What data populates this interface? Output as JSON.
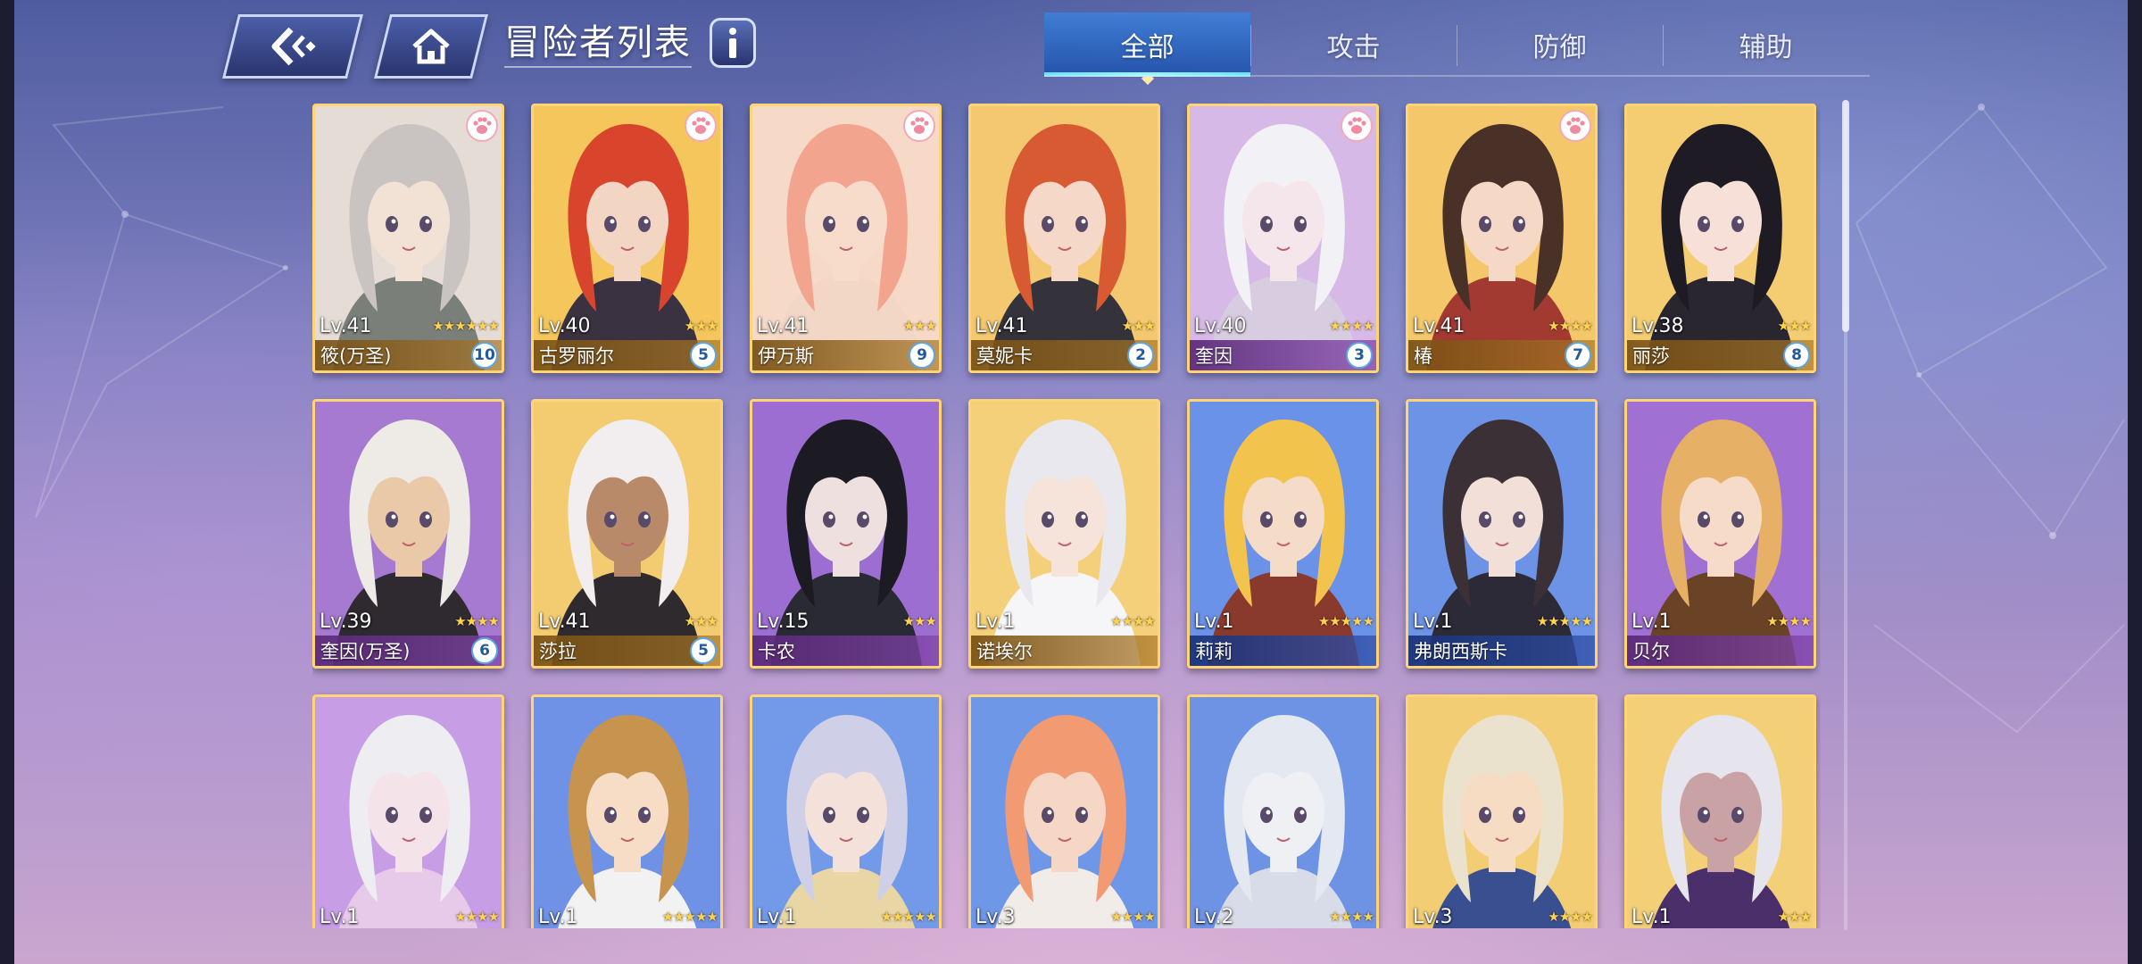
{
  "header": {
    "title": "冒险者列表",
    "tabs": [
      "全部",
      "攻击",
      "防御",
      "辅助"
    ],
    "active_tab": 0
  },
  "colors": {
    "gold": "#ffd474",
    "accent": "#6fe0ff",
    "star": "#ffd34f"
  },
  "cards": [
    {
      "level": "Lv.41",
      "name": "筱(万圣)",
      "rank": "10",
      "stars": "★★★★★★",
      "frame": "gold",
      "paw": true,
      "skin": "#f2e2d6",
      "hair": "#c9c4c2",
      "cloth": "#7a7f7a",
      "bg": "#e6dcd6"
    },
    {
      "level": "Lv.40",
      "name": "古罗丽尔",
      "rank": "5",
      "stars": "★★★",
      "frame": "gold",
      "paw": true,
      "skin": "#f3d5c4",
      "hair": "#d9452c",
      "cloth": "#3a3240",
      "bg": "#f4c65c"
    },
    {
      "level": "Lv.41",
      "name": "伊万斯",
      "rank": "9",
      "stars": "★★★",
      "frame": "gold",
      "paw": true,
      "skin": "#f7dccb",
      "hair": "#f2a48e",
      "cloth": "#f2d7c6",
      "bg": "#f6d9c6"
    },
    {
      "level": "Lv.41",
      "name": "莫妮卡",
      "rank": "2",
      "stars": "★★★",
      "frame": "gold",
      "paw": false,
      "skin": "#f5d8c8",
      "hair": "#d75a32",
      "cloth": "#34323a",
      "bg": "#f4c870"
    },
    {
      "level": "Lv.40",
      "name": "奎因",
      "rank": "3",
      "stars": "★★★★",
      "frame": "purple",
      "paw": true,
      "skin": "#f4e6ea",
      "hair": "#f2f2f6",
      "cloth": "#d8cde0",
      "bg": "#d6b9e6"
    },
    {
      "level": "Lv.41",
      "name": "椿",
      "rank": "7",
      "stars": "★★★★",
      "frame": "gold",
      "paw": true,
      "skin": "#f6d8c6",
      "hair": "#4a3128",
      "cloth": "#a23a32",
      "bg": "#f3c76a"
    },
    {
      "level": "Lv.38",
      "name": "丽莎",
      "rank": "8",
      "stars": "★★★",
      "frame": "gold",
      "paw": false,
      "skin": "#f7e0d8",
      "hair": "#1f1b24",
      "cloth": "#2a2630",
      "bg": "#f4cd73"
    },
    {
      "level": "Lv.39",
      "name": "奎因(万圣)",
      "rank": "6",
      "stars": "★★★★",
      "frame": "purple",
      "paw": false,
      "skin": "#e9c9a8",
      "hair": "#eeeae6",
      "cloth": "#2f2a30",
      "bg": "#a57ad0"
    },
    {
      "level": "Lv.41",
      "name": "莎拉",
      "rank": "5",
      "stars": "★★★",
      "frame": "gold",
      "paw": false,
      "skin": "#b98a6a",
      "hair": "#f2eef0",
      "cloth": "#2e2a2e",
      "bg": "#f3cc72"
    },
    {
      "level": "Lv.15",
      "name": "卡农",
      "rank": "",
      "stars": "★★★",
      "frame": "purple",
      "paw": false,
      "skin": "#efe0e0",
      "hair": "#1c1a22",
      "cloth": "#2a2a34",
      "bg": "#9c6ed2"
    },
    {
      "level": "Lv.1",
      "name": "诺埃尔",
      "rank": "",
      "stars": "★★★★",
      "frame": "gold",
      "paw": false,
      "skin": "#f6e4da",
      "hair": "#e8e8ee",
      "cloth": "#f6f6f8",
      "bg": "#f4d07a"
    },
    {
      "level": "Lv.1",
      "name": "莉莉",
      "rank": "",
      "stars": "★★★★★",
      "frame": "blue",
      "paw": false,
      "skin": "#f5dcc8",
      "hair": "#f2c44e",
      "cloth": "#8a3a2c",
      "bg": "#6a92e8"
    },
    {
      "level": "Lv.1",
      "name": "弗朗西斯卡",
      "rank": "",
      "stars": "★★★★★",
      "frame": "blue",
      "paw": false,
      "skin": "#f2e0d8",
      "hair": "#3a3036",
      "cloth": "#2c2a36",
      "bg": "#6d93e6"
    },
    {
      "level": "Lv.1",
      "name": "贝尔",
      "rank": "",
      "stars": "★★★★",
      "frame": "purple",
      "paw": false,
      "skin": "#f6dcc8",
      "hair": "#e6b066",
      "cloth": "#6a4226",
      "bg": "#a070d2"
    },
    {
      "level": "Lv.1",
      "name": "",
      "rank": "",
      "stars": "★★★★",
      "frame": "purple",
      "paw": false,
      "skin": "#f4e4ea",
      "hair": "#eeeef2",
      "cloth": "#e7c9ea",
      "bg": "#c79ee6"
    },
    {
      "level": "Lv.1",
      "name": "",
      "rank": "",
      "stars": "★★★★★",
      "frame": "blue",
      "paw": false,
      "skin": "#f7dcc6",
      "hair": "#c79450",
      "cloth": "#f2f2f2",
      "bg": "#6f92e6"
    },
    {
      "level": "Lv.1",
      "name": "",
      "rank": "",
      "stars": "★★★★★",
      "frame": "blue",
      "paw": false,
      "skin": "#f4e2da",
      "hair": "#cfd0e8",
      "cloth": "#e8d6a4",
      "bg": "#739ae8"
    },
    {
      "level": "Lv.3",
      "name": "",
      "rank": "",
      "stars": "★★★★",
      "frame": "blue",
      "paw": false,
      "skin": "#f6d6c4",
      "hair": "#f29a72",
      "cloth": "#f2ece8",
      "bg": "#6f97e8"
    },
    {
      "level": "Lv.2",
      "name": "",
      "rank": "",
      "stars": "★★★★",
      "frame": "blue",
      "paw": false,
      "skin": "#eef0f4",
      "hair": "#e4e8f0",
      "cloth": "#d8dce8",
      "bg": "#6e93e4"
    },
    {
      "level": "Lv.3",
      "name": "",
      "rank": "",
      "stars": "★★★★",
      "frame": "gold",
      "paw": false,
      "skin": "#f6dcc2",
      "hair": "#eae2cc",
      "cloth": "#3a4f90",
      "bg": "#f3cd73"
    },
    {
      "level": "Lv.1",
      "name": "",
      "rank": "",
      "stars": "★★★",
      "frame": "gold",
      "paw": false,
      "skin": "#c9a2a6",
      "hair": "#e6e4ec",
      "cloth": "#4a2f6a",
      "bg": "#f3cf78"
    }
  ]
}
